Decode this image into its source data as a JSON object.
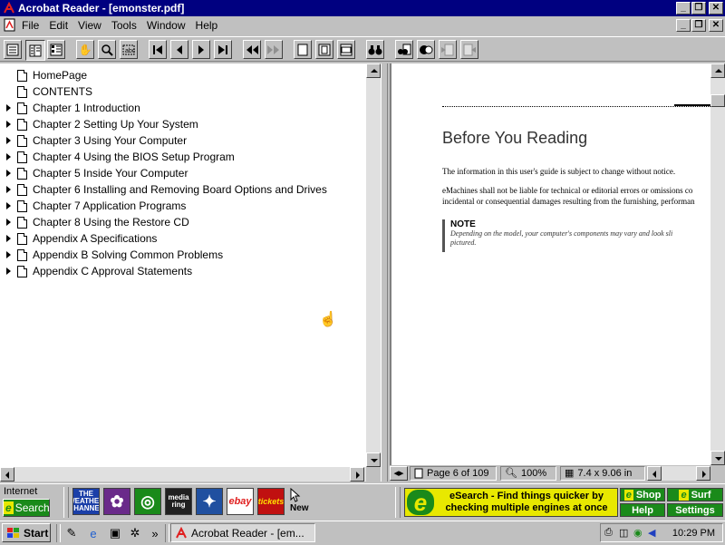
{
  "window": {
    "title": "Acrobat Reader - [emonster.pdf]",
    "caption_buttons": [
      "_",
      "❐",
      "✕"
    ]
  },
  "menu": {
    "items": [
      "File",
      "Edit",
      "View",
      "Tools",
      "Window",
      "Help"
    ]
  },
  "bookmarks": [
    {
      "label": "HomePage",
      "expandable": false
    },
    {
      "label": "CONTENTS",
      "expandable": false
    },
    {
      "label": "Chapter 1  Introduction",
      "expandable": true
    },
    {
      "label": "Chapter 2  Setting Up Your System",
      "expandable": true
    },
    {
      "label": "Chapter 3  Using Your Computer",
      "expandable": true
    },
    {
      "label": "Chapter 4  Using the BIOS Setup Program",
      "expandable": true
    },
    {
      "label": "Chapter 5  Inside Your Computer",
      "expandable": true
    },
    {
      "label": "Chapter 6  Installing and Removing Board Options and Drives",
      "expandable": true
    },
    {
      "label": "Chapter 7  Application Programs",
      "expandable": true
    },
    {
      "label": "Chapter 8  Using the Restore CD",
      "expandable": true
    },
    {
      "label": "Appendix A  Specifications",
      "expandable": true
    },
    {
      "label": "Appendix B  Solving Common Problems",
      "expandable": true
    },
    {
      "label": "Appendix C  Approval Statements",
      "expandable": true
    }
  ],
  "document": {
    "heading": "Before You Reading",
    "para1": "The information in this user's guide is subject to change without notice.",
    "para2_line1": "eMachines shall not be liable for technical or editorial errors or omissions co",
    "para2_line2": "incidental or consequential damages resulting from the furnishing, performan",
    "note_title": "NOTE",
    "note_line1": "Depending on the model, your computer's components may vary and look sli",
    "note_line2": "pictured."
  },
  "status": {
    "page": "Page 6 of 109",
    "zoom": "100%",
    "page_size": "7.4 x 9.06 in"
  },
  "internet_band": {
    "label": "Internet",
    "search_label": "Search",
    "quick_launch": [
      {
        "name": "The Weather Channel",
        "text": "THE WEATHER CHANNEL",
        "color": "#1b3fa8"
      },
      {
        "name": "Flower",
        "text": "✿",
        "color": "#6a2a8a"
      },
      {
        "name": "Greetings",
        "text": "◎",
        "color": "#1a8a1a"
      },
      {
        "name": "Media Ring",
        "text": "media ring",
        "color": "#202020"
      },
      {
        "name": "Compass",
        "text": "✦",
        "color": "#2050a0"
      },
      {
        "name": "eBay",
        "text": "ebay",
        "color": "#ffffff"
      },
      {
        "name": "Tickets",
        "text": "tickets",
        "color": "#c01010"
      }
    ],
    "new_label": "New",
    "ad_text": "eSearch - Find things quicker by checking multiple engines at once",
    "ad_logo": "e",
    "buttons": {
      "shop": "Shop",
      "surf": "Surf",
      "help": "Help",
      "settings": "Settings"
    }
  },
  "taskbar": {
    "start_label": "Start",
    "task_label": "Acrobat Reader - [em...",
    "clock": "10:29 PM",
    "overflow": "»"
  }
}
